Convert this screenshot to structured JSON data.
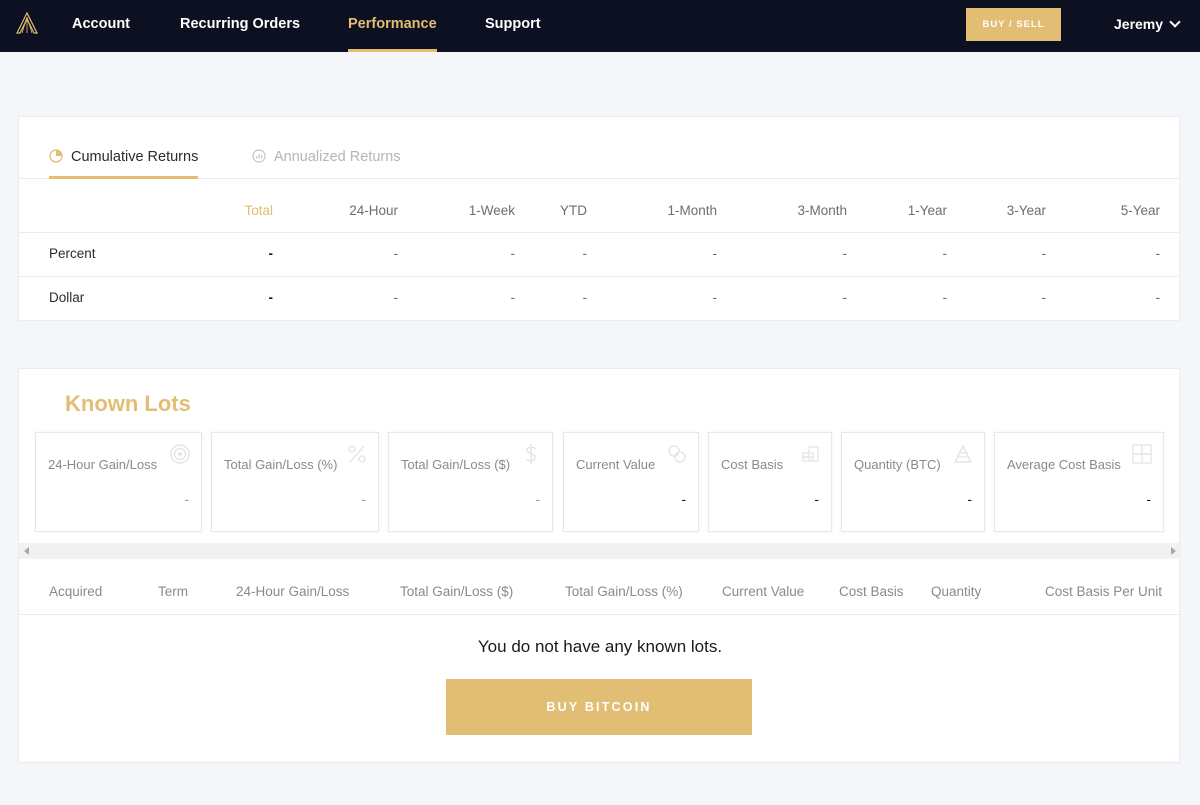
{
  "nav": {
    "items": [
      {
        "label": "Account",
        "active": false
      },
      {
        "label": "Recurring Orders",
        "active": false
      },
      {
        "label": "Performance",
        "active": true
      },
      {
        "label": "Support",
        "active": false
      }
    ],
    "buy_sell_label": "BUY / SELL",
    "user_name": "Jeremy"
  },
  "returns": {
    "tabs": [
      {
        "label": "Cumulative Returns",
        "active": true,
        "icon": "pie-chart-icon"
      },
      {
        "label": "Annualized Returns",
        "active": false,
        "icon": "bar-chart-circle-icon"
      }
    ],
    "columns": [
      "Total",
      "24-Hour",
      "1-Week",
      "YTD",
      "1-Month",
      "3-Month",
      "1-Year",
      "3-Year",
      "5-Year"
    ],
    "rows": [
      {
        "label": "Percent",
        "values": [
          "-",
          "-",
          "-",
          "-",
          "-",
          "-",
          "-",
          "-",
          "-"
        ]
      },
      {
        "label": "Dollar",
        "values": [
          "-",
          "-",
          "-",
          "-",
          "-",
          "-",
          "-",
          "-",
          "-"
        ]
      }
    ]
  },
  "known_lots": {
    "title": "Known Lots",
    "stats": [
      {
        "label": "24-Hour Gain/Loss",
        "value": "-",
        "icon": "target-icon"
      },
      {
        "label": "Total Gain/Loss (%)",
        "value": "-",
        "icon": "percent-icon"
      },
      {
        "label": "Total Gain/Loss ($)",
        "value": "-",
        "icon": "dollar-icon"
      },
      {
        "label": "Current Value",
        "value": "-",
        "icon": "coins-icon"
      },
      {
        "label": "Cost Basis",
        "value": "-",
        "icon": "coin-stack-icon"
      },
      {
        "label": "Quantity (BTC)",
        "value": "-",
        "icon": "pyramid-icon"
      },
      {
        "label": "Average Cost Basis",
        "value": "-",
        "icon": "grid-icon"
      }
    ],
    "table_columns": [
      "Acquired",
      "Term",
      "24-Hour Gain/Loss",
      "Total Gain/Loss ($)",
      "Total Gain/Loss (%)",
      "Current Value",
      "Cost Basis",
      "Quantity",
      "Cost Basis Per Unit"
    ],
    "empty_message": "You do not have any known lots.",
    "buy_button_label": "BUY BITCOIN"
  },
  "colors": {
    "accent": "#e2bd74",
    "nav_bg": "#0d1020",
    "page_bg": "#f5f6f9"
  }
}
